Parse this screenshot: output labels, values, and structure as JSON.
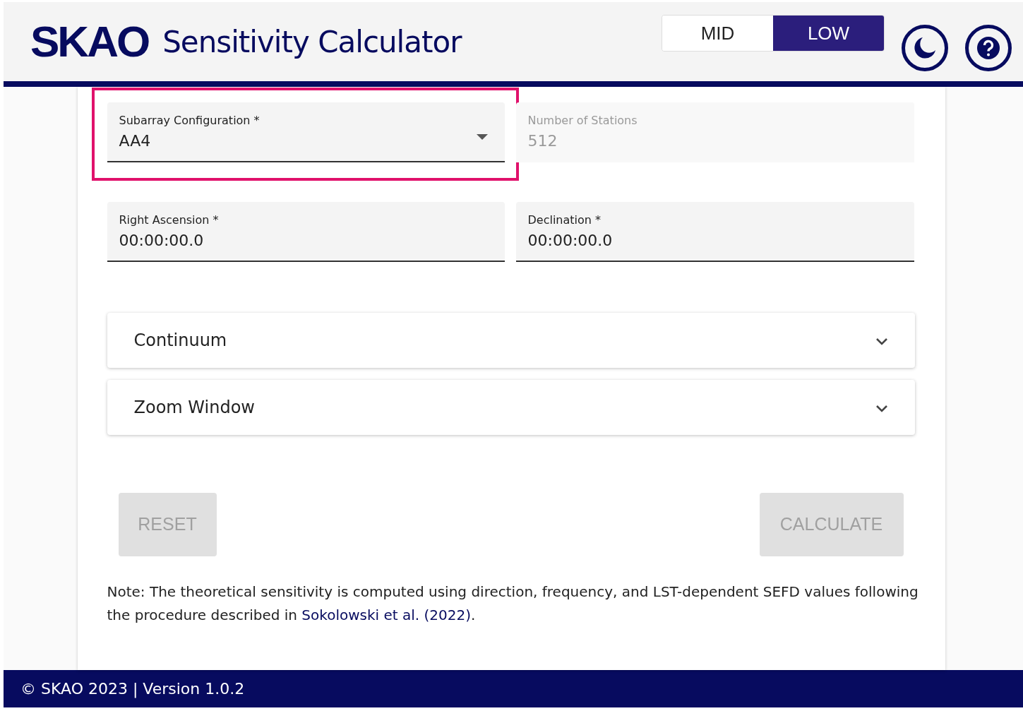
{
  "header": {
    "logo": "SKAO",
    "title": "Sensitivity Calculator",
    "telescopes": [
      {
        "label": "MID",
        "selected": false
      },
      {
        "label": "LOW",
        "selected": true
      }
    ]
  },
  "fields": [
    {
      "kind": "select",
      "label": "Subarray Configuration *",
      "value": "AA4",
      "disabled": false,
      "highlighted": true
    },
    {
      "kind": "text",
      "label": "Number of Stations",
      "value": "512",
      "disabled": true,
      "highlighted": false
    },
    {
      "kind": "text",
      "label": "Right Ascension *",
      "value": "00:00:00.0",
      "disabled": false,
      "highlighted": false
    },
    {
      "kind": "text",
      "label": "Declination *",
      "value": "00:00:00.0",
      "disabled": false,
      "highlighted": false
    }
  ],
  "panels": [
    {
      "title": "Continuum",
      "expanded": false
    },
    {
      "title": "Zoom Window",
      "expanded": false
    }
  ],
  "buttons": [
    {
      "label": "RESET",
      "disabled": true
    },
    {
      "label": "CALCULATE",
      "disabled": true
    }
  ],
  "note": {
    "text": "Note: The theoretical sensitivity is computed using direction, frequency, and LST-dependent SEFD values following the procedure described in",
    "link": "Sokolowski et al. (2022)",
    "after": "."
  },
  "footer": "© SKAO 2023 | Version 1.0.2"
}
